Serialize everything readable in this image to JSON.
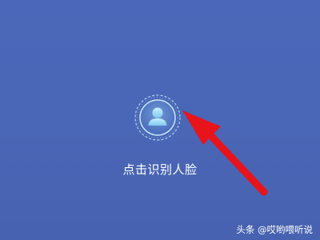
{
  "face_recognition": {
    "label": "点击识别人脸",
    "icon": "face-scan-icon"
  },
  "annotation": {
    "icon": "red-arrow-icon",
    "color": "#e8141c"
  },
  "watermark": {
    "text": "头条 @哎哟喂听说"
  },
  "colors": {
    "background": "#4a66b6",
    "label": "#ffffff",
    "icon_glow": "#8fd3f2"
  }
}
